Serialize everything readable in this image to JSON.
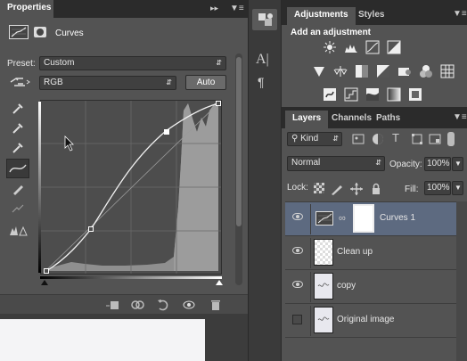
{
  "properties": {
    "tab": "Properties",
    "panel_title": "Curves",
    "preset_label": "Preset:",
    "preset_value": "Custom",
    "channel_value": "RGB",
    "auto_label": "Auto"
  },
  "adjustments": {
    "tabs": [
      "Adjustments",
      "Styles"
    ],
    "add_label": "Add an adjustment"
  },
  "layers_panel": {
    "tabs": [
      "Layers",
      "Channels",
      "Paths"
    ],
    "filter_value": "Kind",
    "blend_mode": "Normal",
    "opacity_label": "Opacity:",
    "opacity_value": "100%",
    "lock_label": "Lock:",
    "fill_label": "Fill:",
    "fill_value": "100%",
    "layers": [
      {
        "name": "Curves 1"
      },
      {
        "name": "Clean up"
      },
      {
        "name": "copy"
      },
      {
        "name": "Original image"
      }
    ]
  },
  "colors": {
    "panel": "#535353",
    "selected_layer": "#5d6a80",
    "accent": "#8ca4c8"
  }
}
